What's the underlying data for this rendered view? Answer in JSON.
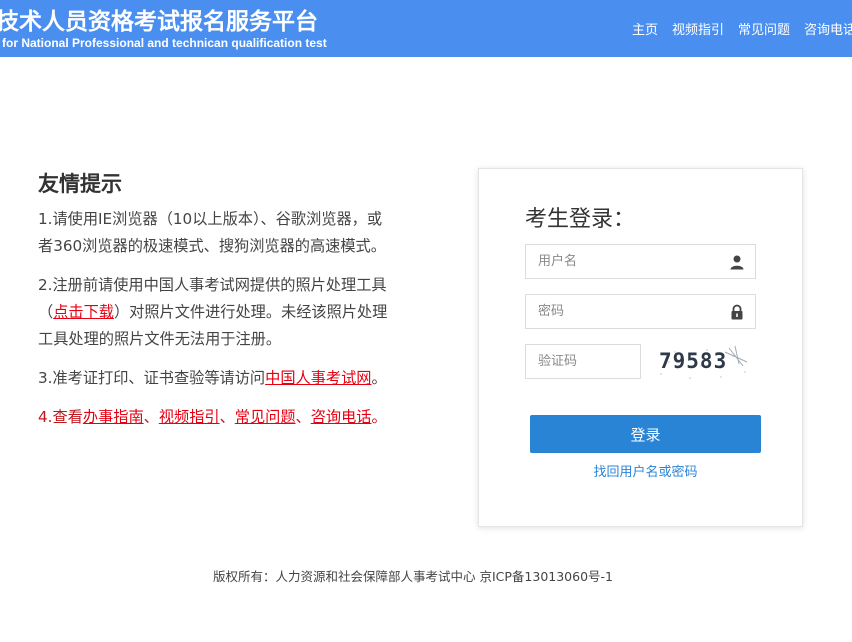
{
  "header": {
    "title": "技术人员资格考试报名服务平台",
    "subtitle": "for National Professional and technican qualification test",
    "nav": [
      "主页",
      "视频指引",
      "常见问题",
      "咨询电话"
    ]
  },
  "tips": {
    "title": "友情提示",
    "tip1": "1.请使用IE浏览器（10以上版本）、谷歌浏览器，或者360浏览器的极速模式、搜狗浏览器的高速模式。",
    "tip1_line1": "1.请使用IE浏览器（10以上版本）、谷歌浏览器，或",
    "tip1_line2": "者360浏览器的极速模式、搜狗浏览器的高速模式。",
    "tip2_line1": "2.注册前请使用中国人事考试网提供的照片处理工具",
    "tip2_pre": "（",
    "tip2_link": "点击下载",
    "tip2_post": "）对照片文件进行处理。未经该照片处理",
    "tip2_line3": "工具处理的照片文件无法用于注册。",
    "tip3_pre": "3.准考证打印、证书查验等请访问",
    "tip3_link": "中国人事考试网",
    "tip3_post": "。",
    "tip4_pre": "4.查看",
    "tip4_links": [
      "办事指南",
      "视频指引",
      "常见问题",
      "咨询电话"
    ],
    "tip4_sep": "、",
    "tip4_post": "。"
  },
  "login": {
    "title": "考生登录：",
    "username_placeholder": "用户名",
    "password_placeholder": "密码",
    "captcha_placeholder": "验证码",
    "captcha_text": "79583",
    "button": "登录",
    "recover": "找回用户名或密码"
  },
  "footer": {
    "text": "版权所有：人力资源和社会保障部人事考试中心 京ICP备13013060号-1"
  },
  "colors": {
    "header_bg": "#4a8ff0",
    "link_red": "#e60012",
    "button_blue": "#2a84d6"
  }
}
